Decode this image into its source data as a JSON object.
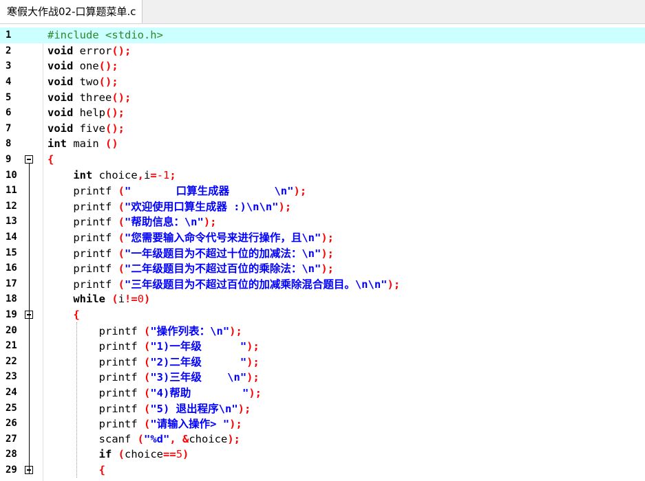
{
  "tab": {
    "title": "寒假大作战02-口算题菜单.c"
  },
  "editor": {
    "lines": [
      [
        [
          "pp",
          "#include <stdio.h>"
        ]
      ],
      [
        [
          "kw",
          "void"
        ],
        [
          "fn",
          " error"
        ],
        [
          "op",
          "();"
        ]
      ],
      [
        [
          "kw",
          "void"
        ],
        [
          "fn",
          " one"
        ],
        [
          "op",
          "();"
        ]
      ],
      [
        [
          "kw",
          "void"
        ],
        [
          "fn",
          " two"
        ],
        [
          "op",
          "();"
        ]
      ],
      [
        [
          "kw",
          "void"
        ],
        [
          "fn",
          " three"
        ],
        [
          "op",
          "();"
        ]
      ],
      [
        [
          "kw",
          "void"
        ],
        [
          "fn",
          " help"
        ],
        [
          "op",
          "();"
        ]
      ],
      [
        [
          "kw",
          "void"
        ],
        [
          "fn",
          " five"
        ],
        [
          "op",
          "();"
        ]
      ],
      [
        [
          "kw",
          "int"
        ],
        [
          "fn",
          " main "
        ],
        [
          "op",
          "()"
        ]
      ],
      [
        [
          "op",
          "{"
        ]
      ],
      [
        [
          "fn",
          "    "
        ],
        [
          "kw",
          "int"
        ],
        [
          "fn",
          " choice"
        ],
        [
          "op",
          ","
        ],
        [
          "fn",
          "i"
        ],
        [
          "op",
          "="
        ],
        [
          "num",
          "-1"
        ],
        [
          "op",
          ";"
        ]
      ],
      [
        [
          "fn",
          "    printf "
        ],
        [
          "op",
          "("
        ],
        [
          "str",
          "\"       口算生成器       \\n\""
        ],
        [
          "op",
          ");"
        ]
      ],
      [
        [
          "fn",
          "    printf "
        ],
        [
          "op",
          "("
        ],
        [
          "str",
          "\"欢迎使用口算生成器 :)\\n\\n\""
        ],
        [
          "op",
          ");"
        ]
      ],
      [
        [
          "fn",
          "    printf "
        ],
        [
          "op",
          "("
        ],
        [
          "str",
          "\"帮助信息：\\n\""
        ],
        [
          "op",
          ");"
        ]
      ],
      [
        [
          "fn",
          "    printf "
        ],
        [
          "op",
          "("
        ],
        [
          "str",
          "\"您需要输入命令代号来进行操作，且\\n\""
        ],
        [
          "op",
          ");"
        ]
      ],
      [
        [
          "fn",
          "    printf "
        ],
        [
          "op",
          "("
        ],
        [
          "str",
          "\"一年级题目为不超过十位的加减法：\\n\""
        ],
        [
          "op",
          ");"
        ]
      ],
      [
        [
          "fn",
          "    printf "
        ],
        [
          "op",
          "("
        ],
        [
          "str",
          "\"二年级题目为不超过百位的乘除法：\\n\""
        ],
        [
          "op",
          ");"
        ]
      ],
      [
        [
          "fn",
          "    printf "
        ],
        [
          "op",
          "("
        ],
        [
          "str",
          "\"三年级题目为不超过百位的加减乘除混合题目。\\n\\n\""
        ],
        [
          "op",
          ");"
        ]
      ],
      [
        [
          "fn",
          "    "
        ],
        [
          "kw",
          "while"
        ],
        [
          "fn",
          " "
        ],
        [
          "op",
          "("
        ],
        [
          "fn",
          "i"
        ],
        [
          "op",
          "!="
        ],
        [
          "num",
          "0"
        ],
        [
          "op",
          ")"
        ]
      ],
      [
        [
          "fn",
          "    "
        ],
        [
          "op",
          "{"
        ]
      ],
      [
        [
          "fn",
          "        printf "
        ],
        [
          "op",
          "("
        ],
        [
          "str",
          "\"操作列表：\\n\""
        ],
        [
          "op",
          ");"
        ]
      ],
      [
        [
          "fn",
          "        printf "
        ],
        [
          "op",
          "("
        ],
        [
          "str",
          "\"1)一年级      \""
        ],
        [
          "op",
          ");"
        ]
      ],
      [
        [
          "fn",
          "        printf "
        ],
        [
          "op",
          "("
        ],
        [
          "str",
          "\"2)二年级      \""
        ],
        [
          "op",
          ");"
        ]
      ],
      [
        [
          "fn",
          "        printf "
        ],
        [
          "op",
          "("
        ],
        [
          "str",
          "\"3)三年级    \\n\""
        ],
        [
          "op",
          ");"
        ]
      ],
      [
        [
          "fn",
          "        printf "
        ],
        [
          "op",
          "("
        ],
        [
          "str",
          "\"4)帮助        \""
        ],
        [
          "op",
          ");"
        ]
      ],
      [
        [
          "fn",
          "        printf "
        ],
        [
          "op",
          "("
        ],
        [
          "str",
          "\"5) 退出程序\\n\""
        ],
        [
          "op",
          ");"
        ]
      ],
      [
        [
          "fn",
          "        printf "
        ],
        [
          "op",
          "("
        ],
        [
          "str",
          "\"请输入操作> \""
        ],
        [
          "op",
          ");"
        ]
      ],
      [
        [
          "fn",
          "        scanf "
        ],
        [
          "op",
          "("
        ],
        [
          "str",
          "\"%d\""
        ],
        [
          "op",
          ", &"
        ],
        [
          "fn",
          "choice"
        ],
        [
          "op",
          ");"
        ]
      ],
      [
        [
          "fn",
          "        "
        ],
        [
          "kw",
          "if"
        ],
        [
          "fn",
          " "
        ],
        [
          "op",
          "("
        ],
        [
          "fn",
          "choice"
        ],
        [
          "op",
          "=="
        ],
        [
          "num",
          "5"
        ],
        [
          "op",
          ")"
        ]
      ],
      [
        [
          "fn",
          "        "
        ],
        [
          "op",
          "{"
        ]
      ]
    ],
    "line_numbers": [
      "1",
      "2",
      "3",
      "4",
      "5",
      "6",
      "7",
      "8",
      "9",
      "10",
      "11",
      "12",
      "13",
      "14",
      "15",
      "16",
      "17",
      "18",
      "19",
      "20",
      "21",
      "22",
      "23",
      "24",
      "25",
      "26",
      "27",
      "28",
      "29"
    ],
    "fold_lines": [
      9,
      19,
      29
    ],
    "current_line": 1
  }
}
